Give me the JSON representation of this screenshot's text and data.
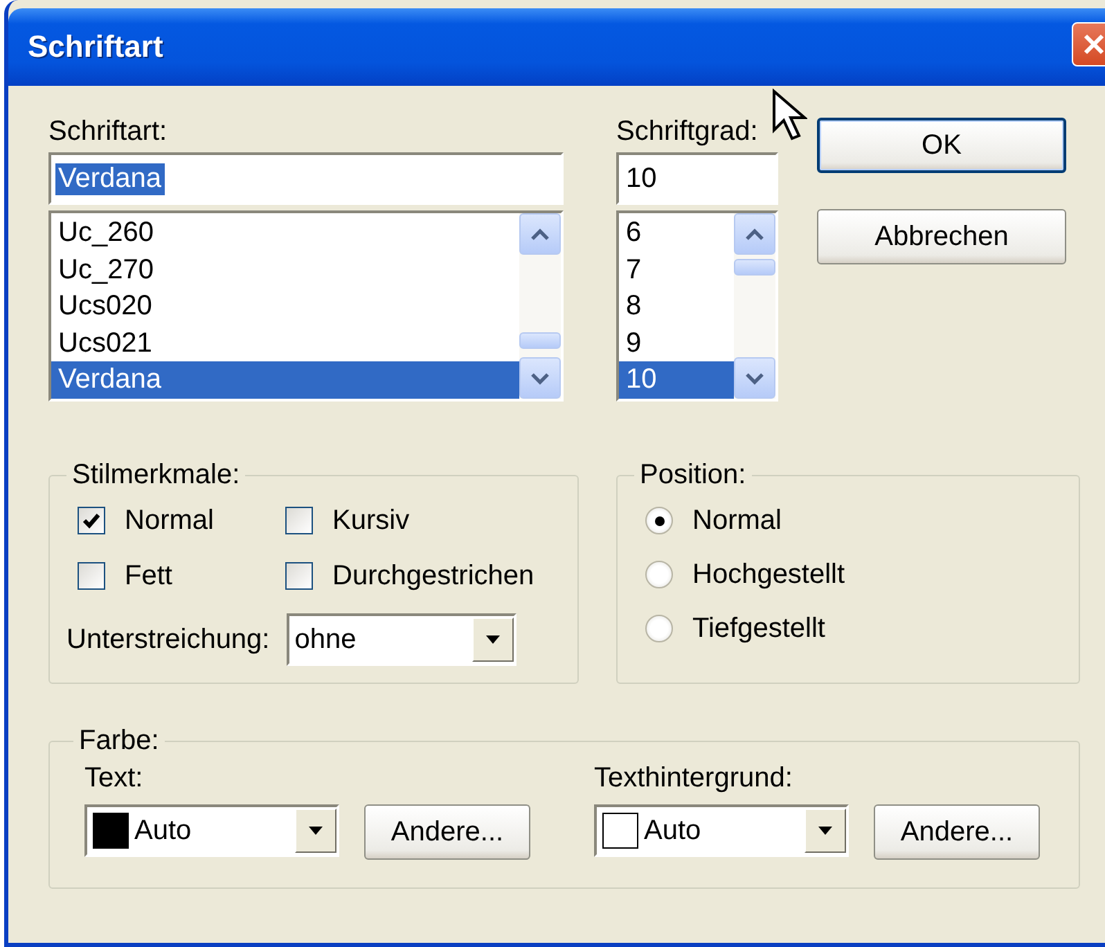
{
  "window": {
    "title": "Schriftart"
  },
  "font": {
    "label": "Schriftart:",
    "value": "Verdana",
    "value_selected": true,
    "items": [
      {
        "label": "Uc_260",
        "selected": false
      },
      {
        "label": "Uc_270",
        "selected": false
      },
      {
        "label": "Ucs020",
        "selected": false
      },
      {
        "label": "Ucs021",
        "selected": false
      },
      {
        "label": "Verdana",
        "selected": true
      }
    ]
  },
  "size": {
    "label": "Schriftgrad:",
    "value": "10",
    "value_selected": false,
    "items": [
      {
        "label": "6",
        "selected": false
      },
      {
        "label": "7",
        "selected": false
      },
      {
        "label": "8",
        "selected": false
      },
      {
        "label": "9",
        "selected": false
      },
      {
        "label": "10",
        "selected": true
      }
    ]
  },
  "buttons": [
    {
      "label": "OK",
      "default": true
    },
    {
      "label": "Abbrechen",
      "default": false
    }
  ],
  "style": {
    "title": "Stilmerkmale:",
    "options": [
      {
        "label": "Normal",
        "checked": true
      },
      {
        "label": "Kursiv",
        "checked": false
      },
      {
        "label": "Fett",
        "checked": false
      },
      {
        "label": "Durchgestrichen",
        "checked": false
      }
    ],
    "underline": {
      "label": "Unterstreichung:",
      "value": "ohne"
    }
  },
  "position": {
    "title": "Position:",
    "options": [
      {
        "label": "Normal",
        "selected": true
      },
      {
        "label": "Hochgestellt",
        "selected": false
      },
      {
        "label": "Tiefgestellt",
        "selected": false
      }
    ]
  },
  "color": {
    "title": "Farbe:",
    "pickers": [
      {
        "label": "Text:",
        "value": "Auto",
        "color": "#000000",
        "button": "Andere..."
      },
      {
        "label": "Texthintergrund:",
        "value": "Auto",
        "color": "#ffffff",
        "button": "Andere..."
      }
    ]
  }
}
